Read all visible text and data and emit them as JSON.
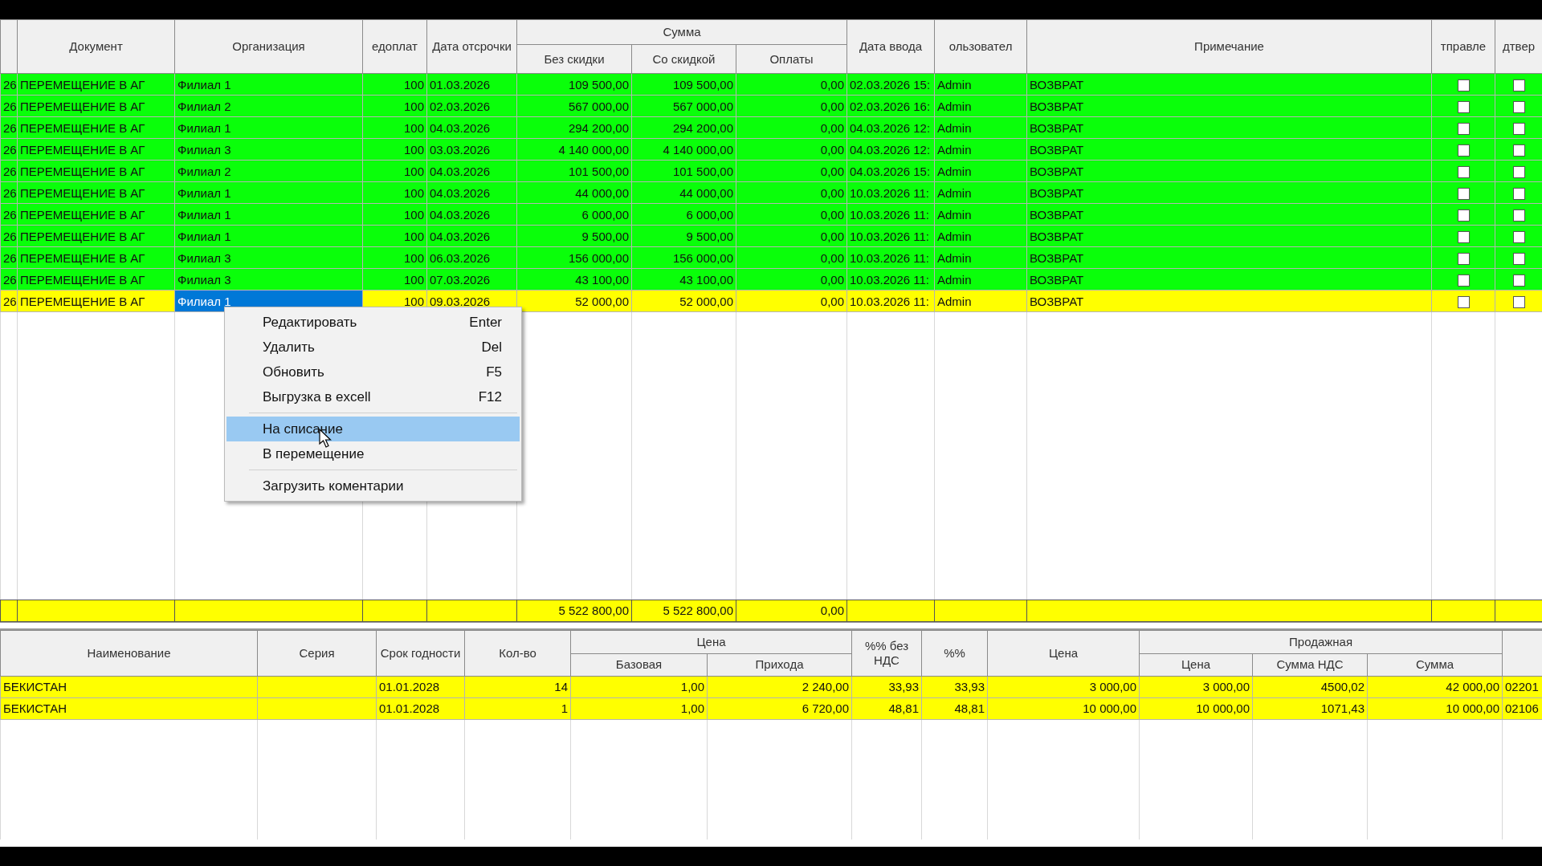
{
  "top_table": {
    "columns": [
      {},
      {
        "label": "Документ"
      },
      {
        "label": "Организация"
      },
      {
        "label": "едоплат"
      },
      {
        "label": "Дата отсрочки"
      },
      {
        "label": "Сумма",
        "colspan": 3,
        "children": [
          "Без скидки",
          "Со скидкой",
          "Оплаты"
        ]
      },
      {
        "label": "Дата ввода"
      },
      {
        "label": "ользовател"
      },
      {
        "label": "Примечание"
      },
      {
        "label": "тправле"
      },
      {
        "label": "дтвер"
      }
    ],
    "rows": [
      {
        "color": "#0aff0a",
        "selected": false,
        "cells": [
          "26",
          "ПЕРЕМЕЩЕНИЕ В АГ",
          "Филиал 1",
          "100",
          "01.03.2026",
          "109 500,00",
          "109 500,00",
          "0,00",
          "02.03.2026 15:",
          "Admin",
          "ВОЗВРАТ"
        ],
        "checks": [
          false,
          false
        ]
      },
      {
        "color": "#0aff0a",
        "selected": false,
        "cells": [
          "26",
          "ПЕРЕМЕЩЕНИЕ В АГ",
          "Филиал 2",
          "100",
          "02.03.2026",
          "567 000,00",
          "567 000,00",
          "0,00",
          "02.03.2026 16:",
          "Admin",
          "ВОЗВРАТ"
        ],
        "checks": [
          false,
          false
        ]
      },
      {
        "color": "#0aff0a",
        "selected": false,
        "cells": [
          "26",
          "ПЕРЕМЕЩЕНИЕ В АГ",
          "Филиал 1",
          "100",
          "04.03.2026",
          "294 200,00",
          "294 200,00",
          "0,00",
          "04.03.2026 12:",
          "Admin",
          "ВОЗВРАТ"
        ],
        "checks": [
          false,
          false
        ]
      },
      {
        "color": "#0aff0a",
        "selected": false,
        "cells": [
          "26",
          "ПЕРЕМЕЩЕНИЕ В АГ",
          "Филиал 3",
          "100",
          "03.03.2026",
          "4 140 000,00",
          "4 140 000,00",
          "0,00",
          "04.03.2026 12:",
          "Admin",
          "ВОЗВРАТ"
        ],
        "checks": [
          false,
          false
        ]
      },
      {
        "color": "#0aff0a",
        "selected": false,
        "cells": [
          "26",
          "ПЕРЕМЕЩЕНИЕ В АГ",
          "Филиал 2",
          "100",
          "04.03.2026",
          "101 500,00",
          "101 500,00",
          "0,00",
          "04.03.2026 15:",
          "Admin",
          "ВОЗВРАТ"
        ],
        "checks": [
          false,
          false
        ]
      },
      {
        "color": "#0aff0a",
        "selected": false,
        "cells": [
          "26",
          "ПЕРЕМЕЩЕНИЕ В АГ",
          "Филиал 1",
          "100",
          "04.03.2026",
          "44 000,00",
          "44 000,00",
          "0,00",
          "10.03.2026 11:",
          "Admin",
          "ВОЗВРАТ"
        ],
        "checks": [
          false,
          false
        ]
      },
      {
        "color": "#0aff0a",
        "selected": false,
        "cells": [
          "26",
          "ПЕРЕМЕЩЕНИЕ В АГ",
          "Филиал 1",
          "100",
          "04.03.2026",
          "6 000,00",
          "6 000,00",
          "0,00",
          "10.03.2026 11:",
          "Admin",
          "ВОЗВРАТ"
        ],
        "checks": [
          false,
          false
        ]
      },
      {
        "color": "#0aff0a",
        "selected": false,
        "cells": [
          "26",
          "ПЕРЕМЕЩЕНИЕ В АГ",
          "Филиал 1",
          "100",
          "04.03.2026",
          "9 500,00",
          "9 500,00",
          "0,00",
          "10.03.2026 11:",
          "Admin",
          "ВОЗВРАТ"
        ],
        "checks": [
          false,
          false
        ]
      },
      {
        "color": "#0aff0a",
        "selected": false,
        "cells": [
          "26",
          "ПЕРЕМЕЩЕНИЕ В АГ",
          "Филиал 3",
          "100",
          "06.03.2026",
          "156 000,00",
          "156 000,00",
          "0,00",
          "10.03.2026 11:",
          "Admin",
          "ВОЗВРАТ"
        ],
        "checks": [
          false,
          false
        ]
      },
      {
        "color": "#0aff0a",
        "selected": false,
        "cells": [
          "26",
          "ПЕРЕМЕЩЕНИЕ В АГ",
          "Филиал 3",
          "100",
          "07.03.2026",
          "43 100,00",
          "43 100,00",
          "0,00",
          "10.03.2026 11:",
          "Admin",
          "ВОЗВРАТ"
        ],
        "checks": [
          false,
          false
        ]
      },
      {
        "color": "#ffff00",
        "selected": true,
        "cells": [
          "26",
          "ПЕРЕМЕЩЕНИЕ В АГ",
          "Филиал 1",
          "100",
          "09.03.2026",
          "52 000,00",
          "52 000,00",
          "0,00",
          "10.03.2026 11:",
          "Admin",
          "ВОЗВРАТ"
        ],
        "checks": [
          false,
          false
        ]
      }
    ],
    "totals": {
      "without_discount": "5 522 800,00",
      "with_discount": "5 522 800,00",
      "payments": "0,00"
    }
  },
  "context_menu": {
    "items": [
      {
        "kind": "item",
        "label": "Редактировать",
        "shortcut": "Enter",
        "selected": false
      },
      {
        "kind": "item",
        "label": "Удалить",
        "shortcut": "Del",
        "selected": false
      },
      {
        "kind": "item",
        "label": "Обновить",
        "shortcut": "F5",
        "selected": false
      },
      {
        "kind": "item",
        "label": "Выгрузка в excell",
        "shortcut": "F12",
        "selected": false
      },
      {
        "kind": "separator"
      },
      {
        "kind": "item",
        "label": "На списание",
        "selected": true
      },
      {
        "kind": "item",
        "label": "В перемещение",
        "selected": false
      },
      {
        "kind": "separator"
      },
      {
        "kind": "item",
        "label": "Загрузить коментарии",
        "selected": false
      }
    ]
  },
  "bottom_table": {
    "columns": [
      {
        "label": "Наименование"
      },
      {
        "label": "Серия"
      },
      {
        "label": "Срок годности"
      },
      {
        "label": "Кол-во"
      },
      {
        "label": "Цена",
        "colspan": 2,
        "children": [
          "Базовая",
          "Прихода"
        ]
      },
      {
        "label": "%% без НДС"
      },
      {
        "label": "%%"
      },
      {
        "label": "Цена"
      },
      {
        "label": "Продажная",
        "colspan": 3,
        "children": [
          "Цена",
          "Сумма НДС",
          "Сумма"
        ]
      },
      {}
    ],
    "rows": [
      {
        "name": "БЕКИСТАН",
        "expiry": "01.01.2028",
        "qty": "14",
        "base_price": "1,00",
        "incoming_price": "2 240,00",
        "pct_no_vat": "33,93",
        "pct": "33,93",
        "price": "3 000,00",
        "sale_price": "3 000,00",
        "vat_sum": "4500,02",
        "sum": "42 000,00",
        "column_13": "02201"
      },
      {
        "name": "БЕКИСТАН",
        "expiry": "01.01.2028",
        "qty": "1",
        "base_price": "1,00",
        "incoming_price": "6 720,00",
        "pct_no_vat": "48,81",
        "pct": "48,81",
        "price": "10 000,00",
        "sale_price": "10 000,00",
        "vat_sum": "1071,43",
        "sum": "10 000,00",
        "column_13": "02106"
      }
    ]
  }
}
